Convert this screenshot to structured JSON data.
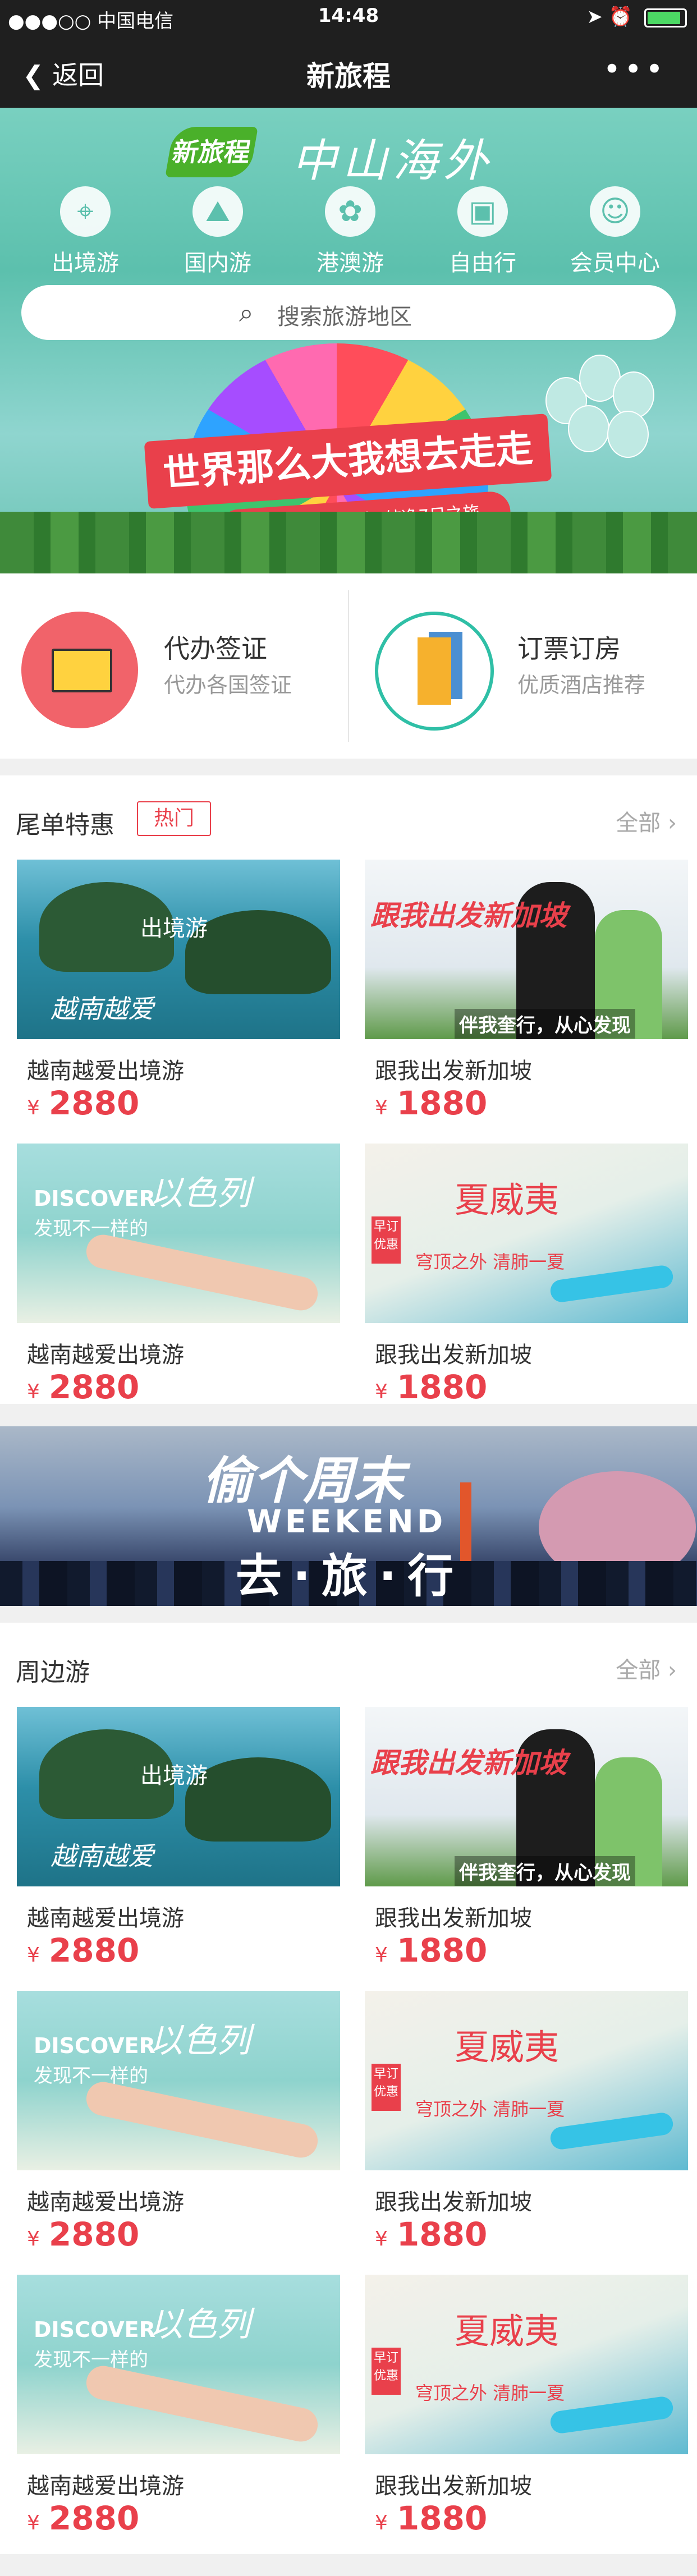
{
  "status_bar": {
    "carrier": "●●●○○ 中国电信",
    "time": "14:48"
  },
  "nav": {
    "back_label": "返回",
    "title": "新旅程",
    "more_icon": "ellipsis-icon"
  },
  "hero": {
    "logo_badge": "新旅程",
    "logo_name": "中山海外",
    "categories": [
      {
        "label": "出境游",
        "icon": "globe-pin-icon",
        "glyph": "⌖"
      },
      {
        "label": "国内游",
        "icon": "china-map-icon",
        "glyph": "⛰"
      },
      {
        "label": "港澳游",
        "icon": "bauhinia-icon",
        "glyph": "✿"
      },
      {
        "label": "自由行",
        "icon": "bus-icon",
        "glyph": "▣"
      },
      {
        "label": "会员中心",
        "icon": "user-icon",
        "glyph": "☺"
      }
    ],
    "search_placeholder": "搜索旅游地区",
    "banner_title": "世界那么大我想去走走",
    "banner_sub": "日韩连线“海陆空”纯净7日之旅"
  },
  "services": [
    {
      "title": "代办签证",
      "subtitle": "代办各国签证",
      "icon": "certificate-icon"
    },
    {
      "title": "订票订房",
      "subtitle": "优质酒店推荐",
      "icon": "hotel-icon"
    }
  ],
  "deals": {
    "title": "尾单特惠",
    "tag": "热门",
    "all_label": "全部",
    "items": [
      {
        "name": "越南越爱出境游",
        "currency": "¥",
        "price": "2880",
        "img_text": "出境游",
        "img_text2": "越南越爱"
      },
      {
        "name": "跟我出发新加坡",
        "currency": "¥",
        "price": "1880",
        "img_text": "跟我出发新加坡",
        "img_text2": "伴我奎行，从心发现"
      },
      {
        "name": "越南越爱出境游",
        "currency": "¥",
        "price": "2880",
        "img_text": "DISCOVER",
        "img_text2": "发现不一样的",
        "img_text3": "以色列"
      },
      {
        "name": "跟我出发新加坡",
        "currency": "¥",
        "price": "1880",
        "img_text": "夏威夷",
        "img_text2": "穹顶之外 清肺一夏",
        "img_tag": "早订优惠"
      }
    ]
  },
  "weekend_banner": {
    "line1": "偷个周末",
    "line2": "WEEKEND",
    "line3": "去·旅·行"
  },
  "nearby": {
    "title": "周边游",
    "all_label": "全部",
    "items": [
      {
        "name": "越南越爱出境游",
        "currency": "¥",
        "price": "2880",
        "img_text": "出境游",
        "img_text2": "越南越爱"
      },
      {
        "name": "跟我出发新加坡",
        "currency": "¥",
        "price": "1880",
        "img_text": "跟我出发新加坡",
        "img_text2": "伴我奎行，从心发现"
      },
      {
        "name": "越南越爱出境游",
        "currency": "¥",
        "price": "2880",
        "img_text": "DISCOVER",
        "img_text2": "发现不一样的",
        "img_text3": "以色列"
      },
      {
        "name": "跟我出发新加坡",
        "currency": "¥",
        "price": "1880",
        "img_text": "夏威夷",
        "img_text2": "穹顶之外 清肺一夏",
        "img_tag": "早订优惠"
      },
      {
        "name": "越南越爱出境游",
        "currency": "¥",
        "price": "2880",
        "img_text": "DISCOVER",
        "img_text2": "发现不一样的",
        "img_text3": "以色列"
      },
      {
        "name": "跟我出发新加坡",
        "currency": "¥",
        "price": "1880",
        "img_text": "夏威夷",
        "img_text2": "穹顶之外 清肺一夏",
        "img_tag": "早订优惠"
      }
    ]
  },
  "colors": {
    "accent": "#e9404b",
    "teal": "#2fbfa6",
    "bar": "#1f1f1f"
  }
}
